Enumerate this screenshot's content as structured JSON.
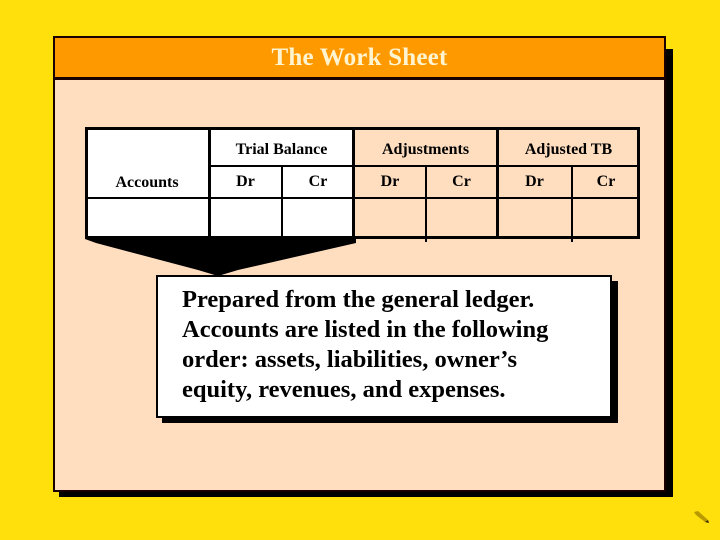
{
  "slide": {
    "title": "The Work Sheet"
  },
  "table": {
    "accounts_label": "Accounts",
    "groups": [
      {
        "label": "Trial Balance",
        "dr": "Dr",
        "cr": "Cr"
      },
      {
        "label": "Adjustments",
        "dr": "Dr",
        "cr": "Cr"
      },
      {
        "label": "Adjusted TB",
        "dr": "Dr",
        "cr": "Cr"
      }
    ]
  },
  "callout": {
    "lines": [
      "Prepared from the general ledger.",
      "Accounts are listed in the following",
      "order:  assets, liabilities, owner’s",
      "equity, revenues, and expenses."
    ]
  },
  "colors": {
    "background": "#FFDF0C",
    "header": "#FF9900",
    "panel": "#FFDEC0",
    "title_text": "#FFF4D0"
  },
  "icons": {
    "corner": "pen-icon"
  }
}
